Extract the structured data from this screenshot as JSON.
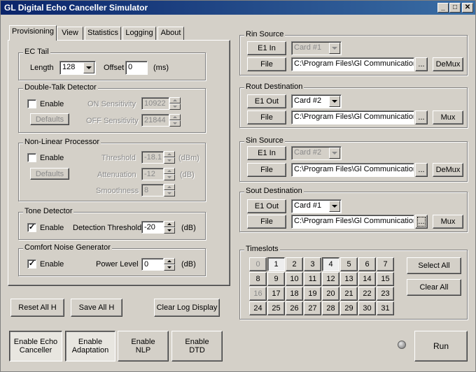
{
  "window": {
    "title": "GL Digital Echo Canceller Simulator",
    "buttons": {
      "minimize": "_",
      "maximize": "□",
      "close": "✕"
    }
  },
  "tabs": [
    {
      "label": "Provisioning",
      "active": true
    },
    {
      "label": "View"
    },
    {
      "label": "Statistics"
    },
    {
      "label": "Logging"
    },
    {
      "label": "About"
    }
  ],
  "ec_tail": {
    "title": "EC Tail",
    "length_label": "Length",
    "length_value": "128",
    "offset_label": "Offset",
    "offset_value": "0",
    "offset_unit": "(ms)"
  },
  "dtd": {
    "title": "Double-Talk Detector",
    "enable_label": "Enable",
    "enabled": false,
    "defaults_label": "Defaults",
    "on_label": "ON Sensitivity",
    "on_value": "10922",
    "off_label": "OFF Sensitivity",
    "off_value": "21844"
  },
  "nlp": {
    "title": "Non-Linear Processor",
    "enable_label": "Enable",
    "enabled": false,
    "defaults_label": "Defaults",
    "threshold_label": "Threshold",
    "threshold_value": "-18.1",
    "threshold_unit": "(dBm)",
    "attenuation_label": "Attenuation",
    "attenuation_value": "-12",
    "attenuation_unit": "(dB)",
    "smoothness_label": "Smoothness",
    "smoothness_value": "8"
  },
  "tone": {
    "title": "Tone Detector",
    "enable_label": "Enable",
    "enabled": true,
    "threshold_label": "Detection Threshold",
    "threshold_value": "-20",
    "unit": "(dB)"
  },
  "cng": {
    "title": "Comfort Noise Generator",
    "enable_label": "Enable",
    "enabled": true,
    "level_label": "Power Level",
    "level_value": "0",
    "unit": "(dB)"
  },
  "actions": {
    "reset": "Reset All H",
    "save": "Save All H",
    "clear_log": "Clear Log Display"
  },
  "enable_buttons": [
    {
      "line1": "Enable Echo",
      "line2": "Canceller"
    },
    {
      "line1": "Enable",
      "line2": "Adaptation"
    },
    {
      "line1": "Enable",
      "line2": "NLP"
    },
    {
      "line1": "Enable",
      "line2": "DTD"
    }
  ],
  "rin": {
    "title": "Rin Source",
    "port": "E1 In",
    "card": "Card #1",
    "file_label": "File",
    "path": "C:\\Program Files\\Gl Communications",
    "browse": "...",
    "mode": "DeMux"
  },
  "rout": {
    "title": "Rout Destination",
    "port": "E1 Out",
    "card": "Card #2",
    "file_label": "File",
    "path": "C:\\Program Files\\Gl Communications",
    "browse": "...",
    "mode": "Mux"
  },
  "sin": {
    "title": "Sin Source",
    "port": "E1 In",
    "card": "Card #2",
    "file_label": "File",
    "path": "C:\\Program Files\\Gl Communications",
    "browse": "...",
    "mode": "DeMux"
  },
  "sout": {
    "title": "Sout Destination",
    "port": "E1 Out",
    "card": "Card #1",
    "file_label": "File",
    "path": "C:\\Program Files\\Gl Communications",
    "browse": "...",
    "mode": "Mux"
  },
  "timeslots": {
    "title": "Timeslots",
    "cells": [
      "0",
      "1",
      "2",
      "3",
      "4",
      "5",
      "6",
      "7",
      "8",
      "9",
      "10",
      "11",
      "12",
      "13",
      "14",
      "15",
      "16",
      "17",
      "18",
      "19",
      "20",
      "21",
      "22",
      "23",
      "24",
      "25",
      "26",
      "27",
      "28",
      "29",
      "30",
      "31"
    ],
    "disabled": [
      "0",
      "16"
    ],
    "selected": [
      "1",
      "4"
    ],
    "select_all": "Select All",
    "clear_all": "Clear All"
  },
  "run_label": "Run"
}
